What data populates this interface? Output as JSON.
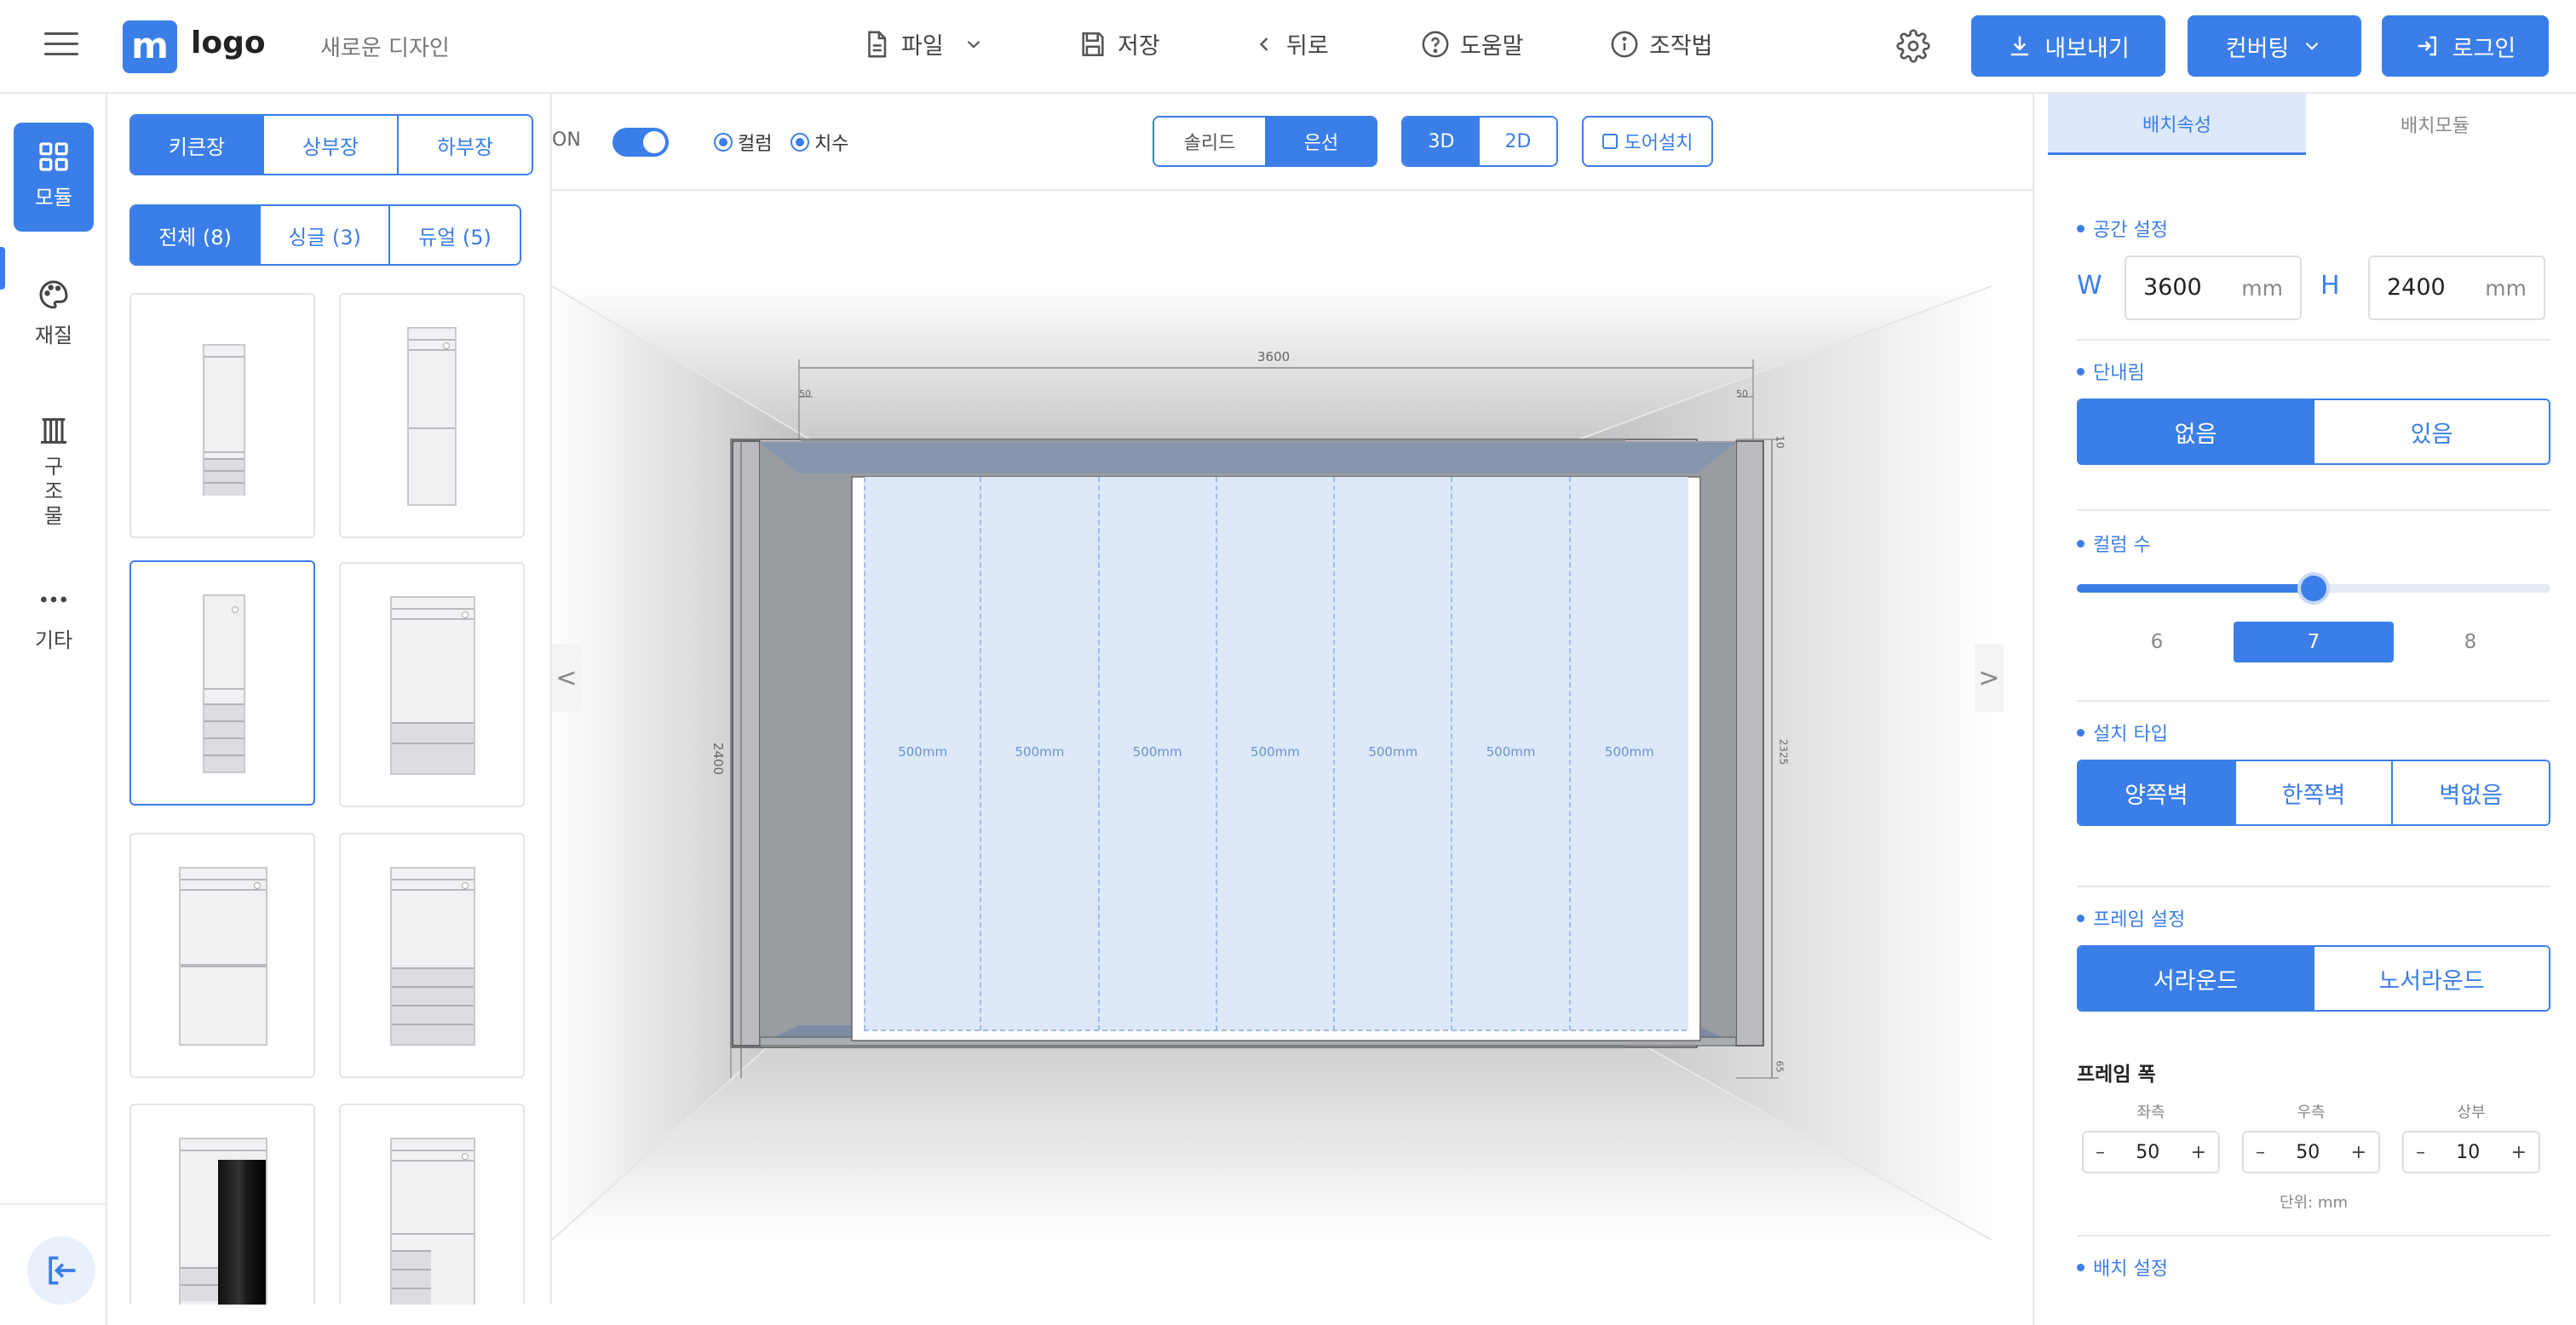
{
  "header": {
    "logo_letter": "m",
    "logo_text": "logo",
    "doc_title": "새로운 디자인",
    "menu": [
      {
        "label": "파일",
        "icon": "file-icon"
      },
      {
        "label": "저장",
        "icon": "save-icon"
      },
      {
        "label": "뒤로",
        "icon": "chevron-left-icon"
      },
      {
        "label": "도움말",
        "icon": "help-icon"
      },
      {
        "label": "조작법",
        "icon": "info-icon"
      }
    ],
    "export_label": "내보내기",
    "convert_label": "컨버팅",
    "login_label": "로그인"
  },
  "rail": {
    "items": [
      {
        "label": "모듈",
        "icon": "grid-icon"
      },
      {
        "label": "재질",
        "icon": "palette-icon"
      },
      {
        "label": "구조물",
        "icon": "columns-icon"
      },
      {
        "label": "기타",
        "icon": "more-icon"
      }
    ]
  },
  "module_panel": {
    "category_tabs": [
      "키큰장",
      "상부장",
      "하부장"
    ],
    "filter_tabs": [
      "전체 (8)",
      "싱글 (3)",
      "듀얼 (5)"
    ],
    "active_category": "키큰장",
    "active_filter": "전체 (8)"
  },
  "toolbar": {
    "on_label": "ON",
    "radio_column": "컬럼",
    "radio_dimension": "치수",
    "render_modes": [
      "솔리드",
      "은선"
    ],
    "view_modes": [
      "3D",
      "2D"
    ],
    "door_label": "도어설치"
  },
  "viewport": {
    "total_width": "3600",
    "total_height": "2400",
    "inner_height": "2325",
    "frame_left": "50",
    "frame_right": "50",
    "frame_top": "10",
    "frame_bottom": "65",
    "column_label": "500mm",
    "column_count": 7,
    "prev_arrow": "<",
    "next_arrow": ">"
  },
  "right_panel": {
    "tabs": [
      "배치속성",
      "배치모듈"
    ],
    "space": {
      "title": "공간 설정",
      "w_label": "W",
      "w_value": "3600",
      "h_label": "H",
      "h_value": "2400",
      "unit": "mm"
    },
    "step": {
      "title": "단내림",
      "options": [
        "없음",
        "있음"
      ],
      "selected": "없음"
    },
    "columns": {
      "title": "컬럼 수",
      "ticks": [
        "6",
        "7",
        "8"
      ],
      "selected": "7",
      "slider_fraction": 0.5
    },
    "install": {
      "title": "설치 타입",
      "options": [
        "양쪽벽",
        "한쪽벽",
        "벽없음"
      ],
      "selected": "양쪽벽"
    },
    "frame": {
      "title": "프레임 설정",
      "options": [
        "서라운드",
        "노서라운드"
      ],
      "selected": "서라운드"
    },
    "frame_width": {
      "title": "프레임 폭",
      "labels": [
        "좌측",
        "우측",
        "상부"
      ],
      "values": [
        "50",
        "50",
        "10"
      ],
      "minus": "–",
      "plus": "+",
      "unit_note": "단위: mm"
    },
    "placement": {
      "title": "배치 설정"
    }
  },
  "colors": {
    "accent": "#3b7ee8",
    "accent_light": "#dde8fa",
    "column_fill": "#dde9f8"
  }
}
